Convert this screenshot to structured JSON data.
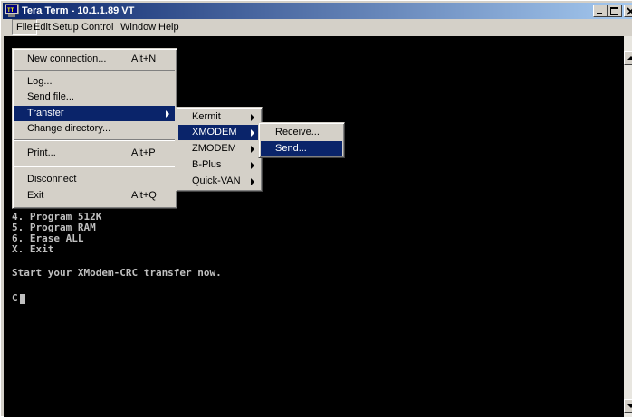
{
  "window": {
    "title": "Tera Term - 10.1.1.89 VT"
  },
  "menubar": {
    "items": [
      "File",
      "Edit",
      "Setup",
      "Control",
      "Window",
      "Help"
    ]
  },
  "file_menu": {
    "items": [
      {
        "label": "New connection...",
        "accel": "Alt+N"
      },
      {
        "label": "Log...",
        "accel": ""
      },
      {
        "label": "Send file...",
        "accel": ""
      },
      {
        "label": "Transfer",
        "accel": "",
        "submenu": true,
        "highlighted": true
      },
      {
        "label": "Change directory...",
        "accel": ""
      },
      {
        "label": "Print...",
        "accel": "Alt+P"
      },
      {
        "label": "Disconnect",
        "accel": ""
      },
      {
        "label": "Exit",
        "accel": "Alt+Q"
      }
    ]
  },
  "transfer_menu": {
    "items": [
      {
        "label": "Kermit",
        "submenu": true
      },
      {
        "label": "XMODEM",
        "submenu": true,
        "highlighted": true
      },
      {
        "label": "ZMODEM",
        "submenu": true
      },
      {
        "label": "B-Plus",
        "submenu": true
      },
      {
        "label": "Quick-VAN",
        "submenu": true
      }
    ]
  },
  "xmodem_menu": {
    "items": [
      {
        "label": "Receive..."
      },
      {
        "label": "Send...",
        "highlighted": true
      }
    ]
  },
  "terminal": {
    "lines": [
      "4. Program 512K",
      "5. Program RAM",
      "6. Erase ALL",
      "X. Exit",
      "",
      "Start your XModem-CRC transfer now.",
      "",
      "C"
    ]
  },
  "colors": {
    "titlebar_start": "#0a246a",
    "titlebar_end": "#a6caf0",
    "menu_highlight": "#0a246a",
    "terminal_bg": "#000000",
    "terminal_fg": "#c0c0c0"
  }
}
